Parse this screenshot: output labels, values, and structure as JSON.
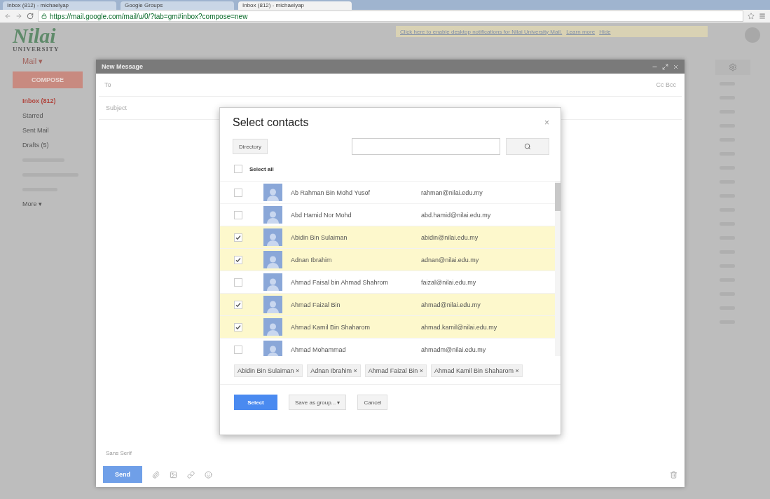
{
  "browser": {
    "tabs": [
      {
        "title": "Inbox (812) - michaelyap",
        "selected": false
      },
      {
        "title": "Google Groups",
        "selected": false
      },
      {
        "title": "Inbox (812) - michaelyap",
        "selected": true
      }
    ],
    "url": "https://mail.google.com/mail/u/0/?tab=gm#inbox?compose=new"
  },
  "logo": {
    "name": "Nilai",
    "subtitle": "UNIVERSITY"
  },
  "notification": {
    "text": "Click here to enable desktop notifications for Nilai University Mail.",
    "links": [
      "Learn more",
      "Hide"
    ]
  },
  "sidebar": {
    "mail_label": "Mail ▾",
    "compose": "COMPOSE",
    "items": [
      {
        "label": "Inbox (812)",
        "selected": true
      },
      {
        "label": "Starred",
        "selected": false
      },
      {
        "label": "Sent Mail",
        "selected": false
      },
      {
        "label": "Drafts (5)",
        "selected": false
      }
    ],
    "more": "More ▾"
  },
  "compose": {
    "title": "New Message",
    "to": "To",
    "cc_bcc": "Cc Bcc",
    "subject_placeholder": "Subject",
    "font": "Sans Serif",
    "send": "Send"
  },
  "dialog": {
    "title": "Select contacts",
    "source": "Directory",
    "select_all": "Select all",
    "select_all_checked": false,
    "contacts": [
      {
        "name": "Ab Rahman Bin Mohd Yusof",
        "email": "rahman@nilai.edu.my",
        "checked": false
      },
      {
        "name": "Abd Hamid Nor Mohd",
        "email": "abd.hamid@nilai.edu.my",
        "checked": false
      },
      {
        "name": "Abidin Bin Sulaiman",
        "email": "abidin@nilai.edu.my",
        "checked": true
      },
      {
        "name": "Adnan Ibrahim",
        "email": "adnan@nilai.edu.my",
        "checked": true
      },
      {
        "name": "Ahmad Faisal bin Ahmad Shahrom",
        "email": "faizal@nilai.edu.my",
        "checked": false
      },
      {
        "name": "Ahmad Faizal Bin",
        "email": "ahmad@nilai.edu.my",
        "checked": true
      },
      {
        "name": "Ahmad Kamil Bin Shaharom",
        "email": "ahmad.kamil@nilai.edu.my",
        "checked": true
      },
      {
        "name": "Ahmad Mohammad",
        "email": "ahmadm@nilai.edu.my",
        "checked": false
      }
    ],
    "chips": [
      "Abidin Bin Sulaiman",
      "Adnan Ibrahim",
      "Ahmad Faizal Bin",
      "Ahmad Kamil Bin Shaharom"
    ],
    "chip_remove": "×",
    "close": "×",
    "select": "Select",
    "save_group": "Save as group... ▾",
    "cancel": "Cancel"
  }
}
